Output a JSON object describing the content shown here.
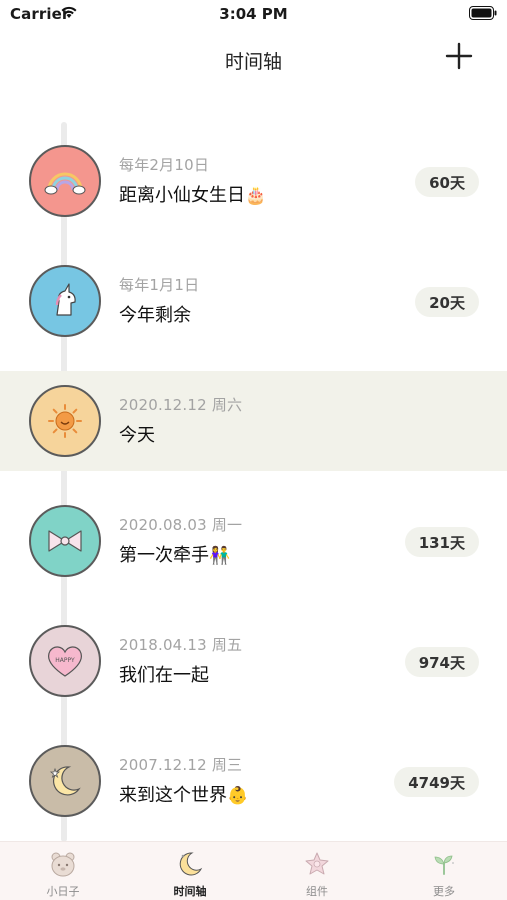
{
  "status_bar": {
    "carrier": "Carrier",
    "time": "3:04 PM"
  },
  "nav": {
    "title": "时间轴"
  },
  "events": [
    {
      "date": "每年2月10日",
      "title": "距离小仙女生日",
      "emoji": "🎂",
      "days": "60天",
      "icon": "rainbow-icon",
      "color": "#f4968e"
    },
    {
      "date": "每年1月1日",
      "title": "今年剩余",
      "emoji": "",
      "days": "20天",
      "icon": "unicorn-icon",
      "color": "#77c6e3"
    },
    {
      "date": "2020.12.12 周六",
      "title": "今天",
      "emoji": "",
      "days": "",
      "icon": "sun-icon",
      "color": "#f6d49b"
    },
    {
      "date": "2020.08.03 周一",
      "title": "第一次牵手",
      "emoji": "👫",
      "days": "131天",
      "icon": "bow-icon",
      "color": "#80d3c7"
    },
    {
      "date": "2018.04.13 周五",
      "title": "我们在一起",
      "emoji": "",
      "days": "974天",
      "icon": "happy-heart-icon",
      "color": "#e8d4d8"
    },
    {
      "date": "2007.12.12 周三",
      "title": "来到这个世界",
      "emoji": "👶",
      "days": "4749天",
      "icon": "moon-icon",
      "color": "#c9bca8"
    }
  ],
  "heart_text": "HAPPY",
  "tabs": [
    {
      "label": "小日子",
      "icon": "bear-icon"
    },
    {
      "label": "时间轴",
      "icon": "moon-icon"
    },
    {
      "label": "组件",
      "icon": "flower-icon"
    },
    {
      "label": "更多",
      "icon": "sprout-icon"
    }
  ]
}
